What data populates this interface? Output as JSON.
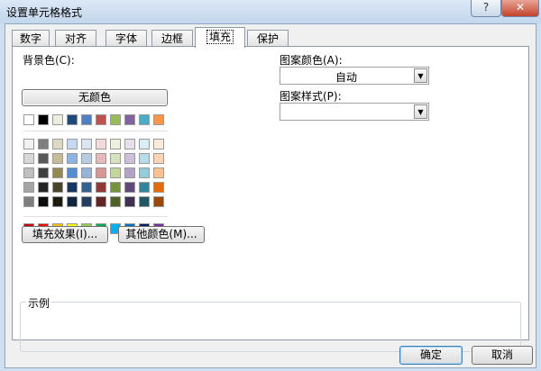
{
  "window": {
    "title": "设置单元格格式",
    "help_label": "?",
    "close_label": "✕"
  },
  "tabs": [
    {
      "label": "数字"
    },
    {
      "label": "对齐"
    },
    {
      "label": "字体"
    },
    {
      "label": "边框"
    },
    {
      "label": "填充",
      "active": true
    },
    {
      "label": "保护"
    }
  ],
  "fill": {
    "background_label": "背景色(C):",
    "no_color_label": "无颜色",
    "fill_effects_label": "填充效果(I)...",
    "more_colors_label": "其他颜色(M)...",
    "pattern_color_label": "图案颜色(A):",
    "pattern_color_value": "自动",
    "pattern_style_label": "图案样式(P):",
    "pattern_style_value": "",
    "sample_label": "示例"
  },
  "palette": {
    "theme_top": [
      "#FFFFFF",
      "#000000",
      "#EEECE1",
      "#1F497D",
      "#4F81BD",
      "#C0504D",
      "#9BBB59",
      "#8064A2",
      "#4BACC6",
      "#F79646"
    ],
    "tints": [
      [
        "#F2F2F2",
        "#7F7F7F",
        "#DDD9C3",
        "#C6D9F0",
        "#DBE5F1",
        "#F2DCDB",
        "#EBF1DD",
        "#E5E0EC",
        "#DBEEF3",
        "#FDEADA"
      ],
      [
        "#D8D8D8",
        "#595959",
        "#C4BD97",
        "#8DB3E2",
        "#B8CCE4",
        "#E5B9B7",
        "#D7E3BC",
        "#CCC1D9",
        "#B7DDE8",
        "#FBD5B5"
      ],
      [
        "#BFBFBF",
        "#3F3F3F",
        "#938953",
        "#548DD4",
        "#95B3D7",
        "#D99694",
        "#C3D69B",
        "#B2A2C7",
        "#92CDDC",
        "#FAC08F"
      ],
      [
        "#A5A5A5",
        "#262626",
        "#494429",
        "#17365D",
        "#366092",
        "#953734",
        "#76923C",
        "#5F497A",
        "#31859B",
        "#E36C09"
      ],
      [
        "#7F7F7F",
        "#0C0C0C",
        "#1D1B10",
        "#0F243E",
        "#244061",
        "#632423",
        "#4F6128",
        "#3F3151",
        "#205867",
        "#974806"
      ]
    ],
    "standard": [
      "#C00000",
      "#FF0000",
      "#FFC000",
      "#FFFF00",
      "#92D050",
      "#00B050",
      "#00B0F0",
      "#0070C0",
      "#002060",
      "#7030A0"
    ]
  },
  "buttons": {
    "ok_label": "确定",
    "cancel_label": "取消"
  }
}
